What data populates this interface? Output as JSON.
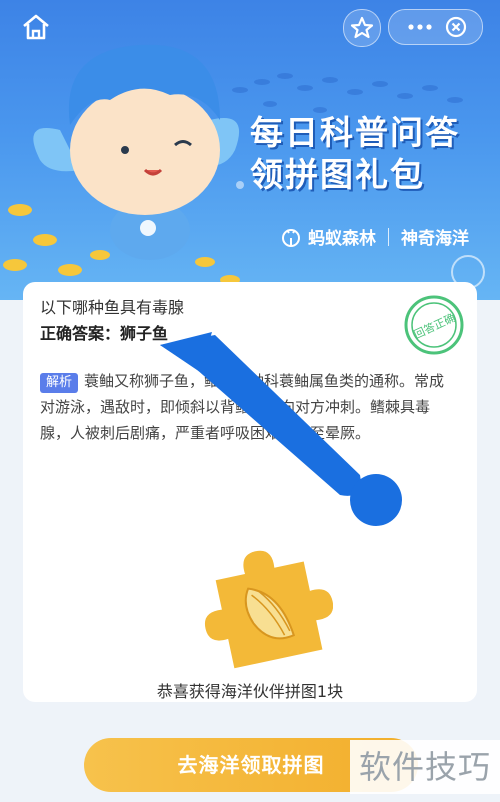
{
  "topbar": {
    "home_icon": "home-icon",
    "star_icon": "star-icon",
    "more_icon": "more-dots-icon",
    "close_icon": "close-icon"
  },
  "banner": {
    "title_line1": "每日科普问答",
    "title_line2": "领拼图礼包",
    "brand_left": "蚂蚁森林",
    "brand_right": "神奇海洋"
  },
  "card": {
    "question": "以下哪种鱼具有毒腺",
    "answer_label": "正确答案：",
    "answer_value": "狮子鱼",
    "stamp_text": "回答正确",
    "analysis_tag": "解析",
    "analysis_text": "蓑鲉又称狮子鱼，鲉形目鲉科蓑鲉属鱼类的通称。常成对游泳，遇敌时，即倾斜以背鳍鳍棘向对方冲刺。鳍棘具毒腺，人被刺后剧痛，严重者呼吸困难，甚至晕厥。",
    "reward_text": "恭喜获得海洋伙伴拼图1块"
  },
  "cta": {
    "label": "去海洋领取拼图"
  },
  "watermark": {
    "text": "软件技巧"
  },
  "colors": {
    "accent_blue": "#4a97ee",
    "tag_blue": "#5a7dea",
    "cta_yellow": "#f4b73a",
    "stamp_green": "#4cc37a"
  }
}
